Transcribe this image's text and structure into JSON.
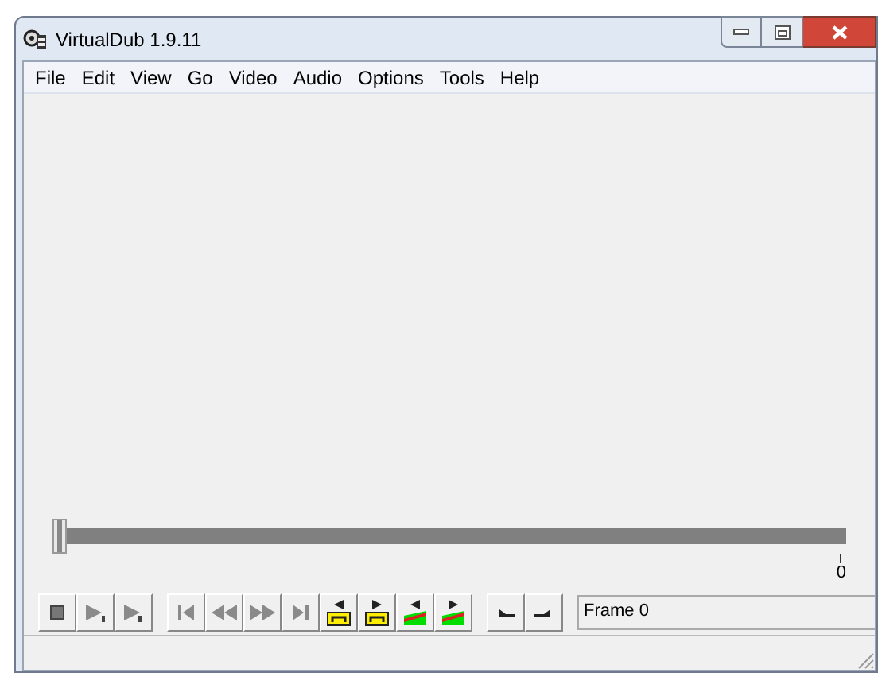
{
  "window": {
    "title": "VirtualDub 1.9.11"
  },
  "menu": [
    "File",
    "Edit",
    "View",
    "Go",
    "Video",
    "Audio",
    "Options",
    "Tools",
    "Help"
  ],
  "position_slider": {
    "level": 0,
    "tick_label": "0"
  },
  "toolbar_groups": [
    {
      "buttons": [
        {
          "kind": "stop"
        },
        {
          "kind": "play-input"
        },
        {
          "kind": "play-output"
        }
      ]
    },
    {
      "buttons": [
        {
          "kind": "start"
        },
        {
          "kind": "prev-key"
        },
        {
          "kind": "next-key"
        },
        {
          "kind": "end"
        },
        {
          "kind": "scene-back"
        },
        {
          "kind": "scene-fwd"
        },
        {
          "kind": "keyframe-back"
        },
        {
          "kind": "keyframe-fwd"
        }
      ]
    },
    {
      "buttons": [
        {
          "kind": "mark-in"
        },
        {
          "kind": "mark-out"
        }
      ]
    }
  ],
  "frame_field": {
    "value": "Frame 0"
  }
}
